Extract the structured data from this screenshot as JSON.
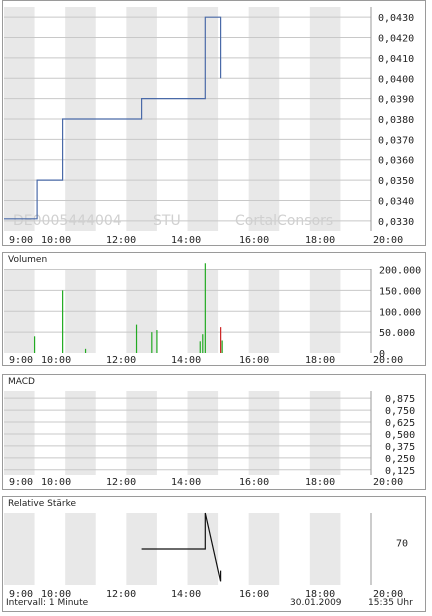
{
  "colors": {
    "shade": "#e8e8e8",
    "grid": "#c8c8c8",
    "line": "#4a6aa8",
    "volume_up": "#22aa22",
    "volume_down": "#cc2222",
    "rsi": "#111111"
  },
  "time_axis": {
    "labels": [
      "9:00",
      "10:00",
      "12:00",
      "14:00",
      "16:00",
      "18:00",
      "20:00"
    ],
    "domain": [
      "08:00",
      "20:00"
    ]
  },
  "price_panel": {
    "watermark_isin": "DE0005444004",
    "watermark_exchange": "STU",
    "watermark_brand": "CortalConsors"
  },
  "volume_panel": {
    "title": "Volumen"
  },
  "macd_panel": {
    "title": "MACD"
  },
  "rsi_panel": {
    "title": "Relative Stärke"
  },
  "footer": {
    "interval": "Intervall: 1 Minute",
    "date": "30.01.2009",
    "time": "15:35 Uhr"
  },
  "chart_data": [
    {
      "type": "line",
      "step": true,
      "ylim": [
        0.0325,
        0.0435
      ],
      "y_ticks": [
        "0,0330",
        "0,0340",
        "0,0350",
        "0,0360",
        "0,0370",
        "0,0380",
        "0,0390",
        "0,0400",
        "0,0410",
        "0,0420",
        "0,0430"
      ],
      "x": [
        "08:00",
        "09:05",
        "09:05",
        "09:55",
        "09:55",
        "12:30",
        "12:30",
        "14:35",
        "14:35",
        "15:05",
        "15:05",
        "15:05",
        "15:05"
      ],
      "y": [
        0.0331,
        0.0331,
        0.035,
        0.035,
        0.038,
        0.038,
        0.039,
        0.039,
        0.043,
        0.043,
        0.04,
        0.042,
        0.04
      ]
    },
    {
      "type": "bar",
      "title": "Volumen",
      "ylim": [
        0,
        230000
      ],
      "y_ticks": [
        "200.000",
        "150.000",
        "100.000",
        "50.000",
        "0"
      ],
      "points": [
        {
          "x": "09:00",
          "value": 40000,
          "dir": "up"
        },
        {
          "x": "09:55",
          "value": 150000,
          "dir": "up"
        },
        {
          "x": "10:40",
          "value": 10000,
          "dir": "up"
        },
        {
          "x": "12:20",
          "value": 68000,
          "dir": "up"
        },
        {
          "x": "12:50",
          "value": 50000,
          "dir": "up"
        },
        {
          "x": "13:00",
          "value": 55000,
          "dir": "up"
        },
        {
          "x": "14:25",
          "value": 28000,
          "dir": "up"
        },
        {
          "x": "14:30",
          "value": 45000,
          "dir": "up"
        },
        {
          "x": "14:35",
          "value": 215000,
          "dir": "up"
        },
        {
          "x": "15:05",
          "value": 62000,
          "dir": "down"
        },
        {
          "x": "15:08",
          "value": 30000,
          "dir": "up"
        }
      ]
    },
    {
      "type": "line",
      "title": "MACD",
      "ylim": [
        0.07,
        0.95
      ],
      "y_ticks": [
        "0,875",
        "0,750",
        "0,625",
        "0,500",
        "0,375",
        "0,250",
        "0,125"
      ],
      "x": [],
      "y": []
    },
    {
      "type": "line",
      "title": "Relative Stärke",
      "ylim": [
        0,
        100
      ],
      "y_ticks": [
        "70"
      ],
      "x": [
        "12:30",
        "14:35",
        "14:35",
        "15:05",
        "15:05"
      ],
      "y": [
        50,
        50,
        100,
        5,
        20
      ]
    }
  ]
}
